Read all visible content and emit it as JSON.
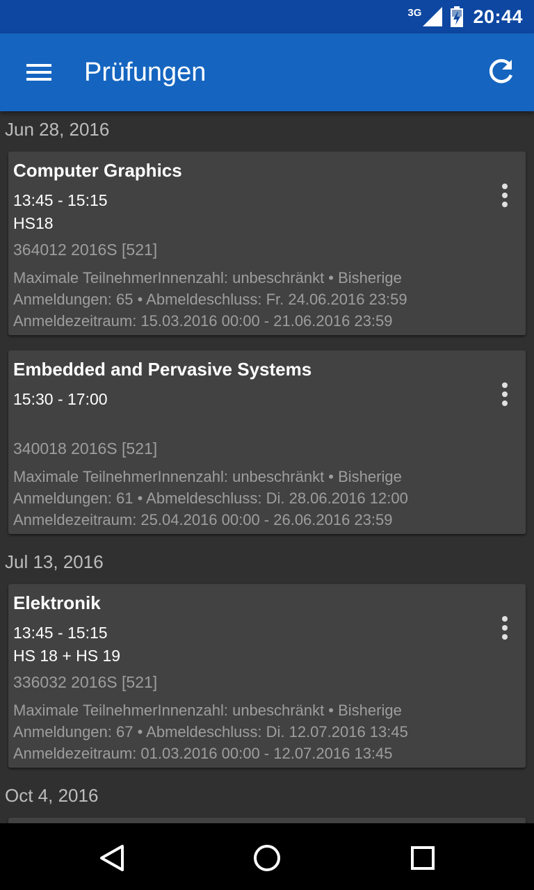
{
  "status_bar": {
    "network": "3G",
    "time": "20:44"
  },
  "app_bar": {
    "title": "Prüfungen",
    "menu_icon": "hamburger-menu-icon",
    "refresh_icon": "refresh-icon"
  },
  "sections": [
    {
      "date": "Jun 28, 2016",
      "cards": [
        {
          "title": "Computer Graphics",
          "time": "13:45 - 15:15",
          "room": "HS18",
          "code": "364012 2016S [521]",
          "info": "Maximale TeilnehmerInnenzahl: unbeschränkt • Bisherige Anmeldungen: 65 • Abmeldeschluss: Fr. 24.06.2016 23:59 Anmeldezeitraum: 15.03.2016 00:00 - 21.06.2016 23:59"
        },
        {
          "title": "Embedded and Pervasive Systems",
          "time": "15:30 - 17:00",
          "room": "",
          "code": "340018 2016S [521]",
          "info": "Maximale TeilnehmerInnenzahl: unbeschränkt • Bisherige Anmeldungen: 61 • Abmeldeschluss: Di. 28.06.2016 12:00 Anmeldezeitraum: 25.04.2016 00:00 - 26.06.2016 23:59"
        }
      ]
    },
    {
      "date": "Jul 13, 2016",
      "cards": [
        {
          "title": "Elektronik",
          "time": "13:45 - 15:15",
          "room": "HS 18 + HS 19",
          "code": "336032 2016S [521]",
          "info": "Maximale TeilnehmerInnenzahl: unbeschränkt • Bisherige Anmeldungen: 67 • Abmeldeschluss: Di. 12.07.2016 13:45 Anmeldezeitraum: 01.03.2016 00:00 - 12.07.2016 13:45"
        }
      ]
    },
    {
      "date": "Oct 4, 2016",
      "cards": []
    }
  ],
  "nav_bar": {
    "back_icon": "back-triangle-icon",
    "home_icon": "home-circle-icon",
    "recents_icon": "recents-square-icon"
  },
  "colors": {
    "status_bar": "#0d47a1",
    "app_bar": "#1565c0",
    "background": "#303030",
    "card": "#424242",
    "secondary_text": "#9e9e9e"
  }
}
